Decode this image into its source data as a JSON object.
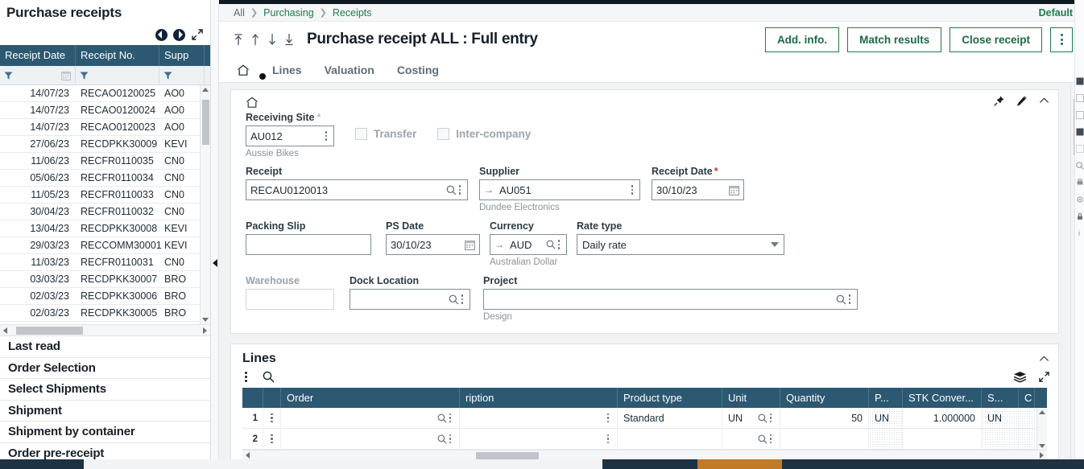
{
  "left_panel": {
    "title": "Purchase receipts",
    "nav": {
      "prev_icon": "circle-left-arrow-icon",
      "next_icon": "circle-right-arrow-icon",
      "expand_icon": "expand-diagonal-icon"
    },
    "grid": {
      "columns": [
        "Receipt Date",
        "Receipt No.",
        "Supp"
      ],
      "rows": [
        {
          "date": "14/07/23",
          "no": "RECAO0120025",
          "supplier": "AO0"
        },
        {
          "date": "14/07/23",
          "no": "RECAO0120024",
          "supplier": "AO0"
        },
        {
          "date": "14/07/23",
          "no": "RECAO0120023",
          "supplier": "AO0"
        },
        {
          "date": "27/06/23",
          "no": "RECDPKK30009",
          "supplier": "KEVI"
        },
        {
          "date": "11/06/23",
          "no": "RECFR0110035",
          "supplier": "CN0"
        },
        {
          "date": "05/06/23",
          "no": "RECFR0110034",
          "supplier": "CN0"
        },
        {
          "date": "11/05/23",
          "no": "RECFR0110033",
          "supplier": "CN0"
        },
        {
          "date": "30/04/23",
          "no": "RECFR0110032",
          "supplier": "CN0"
        },
        {
          "date": "13/04/23",
          "no": "RECDPKK30008",
          "supplier": "KEVI"
        },
        {
          "date": "29/03/23",
          "no": "RECCOMM30001",
          "supplier": "KEVI"
        },
        {
          "date": "11/03/23",
          "no": "RECFR0110031",
          "supplier": "CN0"
        },
        {
          "date": "03/03/23",
          "no": "RECDPKK30007",
          "supplier": "BRO"
        },
        {
          "date": "02/03/23",
          "no": "RECDPKK30006",
          "supplier": "BRO"
        },
        {
          "date": "02/03/23",
          "no": "RECDPKK30005",
          "supplier": "BRO"
        }
      ]
    },
    "nav_items": [
      "Last read",
      "Order Selection",
      "Select Shipments",
      "Shipment",
      "Shipment by container",
      "Order pre-receipt"
    ]
  },
  "header": {
    "breadcrumb": [
      "All",
      "Purchasing",
      "Receipts"
    ],
    "default_label": "Default",
    "title": "Purchase receipt ALL : Full entry",
    "nav_arrows": [
      "first-record-icon",
      "previous-record-icon",
      "next-record-icon",
      "last-record-icon"
    ],
    "buttons": [
      "Add. info.",
      "Match results",
      "Close receipt"
    ],
    "kebab_label": "more-actions"
  },
  "tabs": [
    {
      "label": "home-icon",
      "is_icon": true,
      "active": true
    },
    {
      "label": "Lines",
      "is_icon": false,
      "active": false
    },
    {
      "label": "Valuation",
      "is_icon": false,
      "active": false
    },
    {
      "label": "Costing",
      "is_icon": false,
      "active": false
    }
  ],
  "form": {
    "tools": [
      "pin-icon",
      "pencil-icon",
      "collapse-chevron-icon"
    ],
    "receiving_site": {
      "label": "Receiving Site",
      "value": "AU012",
      "note": "Aussie Bikes"
    },
    "transfer": {
      "label": "Transfer",
      "checked": false
    },
    "inter_company": {
      "label": "Inter-company",
      "checked": false
    },
    "receipt": {
      "label": "Receipt",
      "value": "RECAU0120013"
    },
    "supplier": {
      "label": "Supplier",
      "value": "AU051",
      "note": "Dundee Electronics"
    },
    "receipt_date": {
      "label": "Receipt Date",
      "value": "30/10/23",
      "required": true
    },
    "packing_slip": {
      "label": "Packing Slip",
      "value": ""
    },
    "ps_date": {
      "label": "PS Date",
      "value": "30/10/23"
    },
    "currency": {
      "label": "Currency",
      "value": "AUD",
      "note": "Australian Dollar"
    },
    "rate_type": {
      "label": "Rate type",
      "value": "Daily rate"
    },
    "warehouse": {
      "label": "Warehouse",
      "value": "",
      "disabled": true
    },
    "dock_location": {
      "label": "Dock Location",
      "value": ""
    },
    "project": {
      "label": "Project",
      "value": "",
      "note": "Design"
    }
  },
  "lines": {
    "title": "Lines",
    "tools": [
      "collapse-chevron-icon",
      "layers-icon",
      "expand-icon"
    ],
    "toolbar": [
      "kebab-icon",
      "search-icon"
    ],
    "columns": [
      "Order",
      "ription",
      "Product type",
      "Unit",
      "Quantity",
      "P...",
      "STK Conver...",
      "S...",
      "C"
    ],
    "rows": [
      {
        "num": "1",
        "order": "",
        "description": "",
        "product_type": "Standard",
        "unit": "UN",
        "quantity": "50",
        "p": "UN",
        "stk_conversion": "1.000000",
        "s": "UN",
        "c": ""
      },
      {
        "num": "2",
        "order": "",
        "description": "",
        "product_type": "",
        "unit": "",
        "quantity": "",
        "p": "",
        "stk_conversion": "",
        "s": "",
        "c": ""
      }
    ]
  }
}
